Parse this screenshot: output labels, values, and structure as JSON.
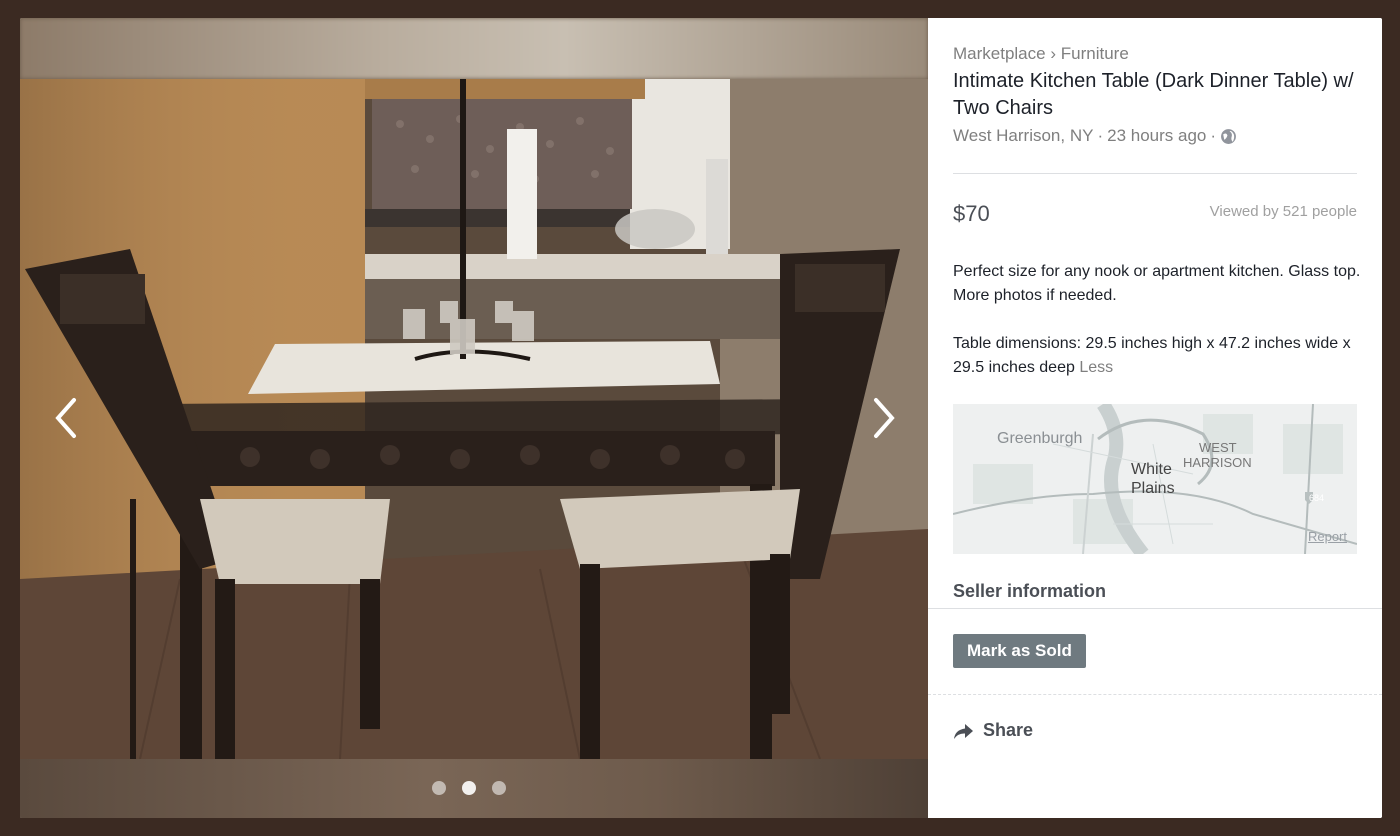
{
  "listing": {
    "breadcrumb": {
      "root": "Marketplace",
      "separator": "›",
      "category": "Furniture"
    },
    "title": "Intimate Kitchen Table (Dark Dinner Table) w/ Two Chairs",
    "location": "West Harrison, NY",
    "posted": "23 hours ago",
    "meta_separator": "·",
    "visibility_icon": "globe-icon",
    "price": "$70",
    "views": "Viewed by 521 people",
    "description": [
      "Perfect size for any nook or apartment kitchen. Glass top. More photos if needed.",
      "Table dimensions: 29.5 inches high x 47.2 inches wide x 29.5 inches deep"
    ],
    "less_link": "Less"
  },
  "map": {
    "labels": [
      "Greenburgh",
      "White",
      "Plains",
      "WEST",
      "HARRISON",
      "684"
    ],
    "report_link": "Report"
  },
  "seller": {
    "section_title": "Seller information",
    "mark_sold_label": "Mark as Sold"
  },
  "share": {
    "label": "Share",
    "icon": "share-arrow-icon"
  },
  "gallery": {
    "photo_count": 3,
    "active_index": 1,
    "photo_description": "dark table with two chairs in kitchen nook"
  }
}
